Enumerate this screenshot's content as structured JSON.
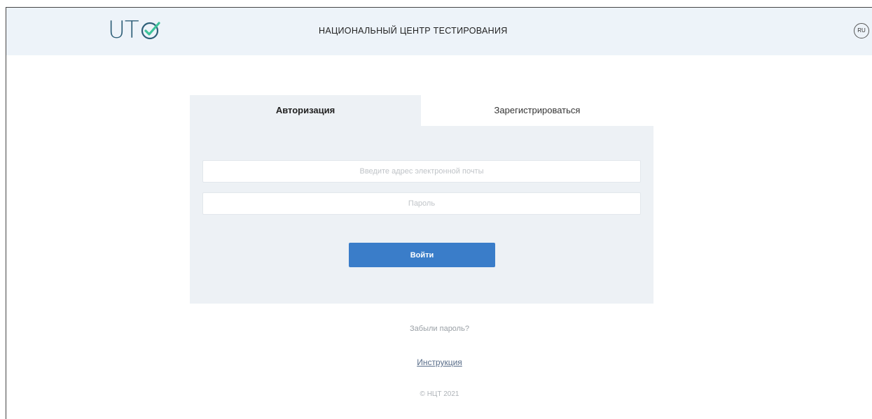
{
  "header": {
    "logo_text": "UT",
    "title": "НАЦИОНАЛЬНЫЙ ЦЕНТР ТЕСТИРОВАНИЯ",
    "language": "RU"
  },
  "tabs": [
    {
      "label": "Авторизация",
      "active": true
    },
    {
      "label": "Зарегистрироваться",
      "active": false
    }
  ],
  "form": {
    "email_placeholder": "Введите адрес электронной почты",
    "password_placeholder": "Пароль",
    "submit_label": "Войти"
  },
  "footer": {
    "forgot_label": "Забыли пароль?",
    "instructions_label": "Инструкция",
    "copyright": "© НЦТ 2021"
  },
  "colors": {
    "header_bg": "#edf3f9",
    "panel_bg": "#edf1f5",
    "accent": "#3a7dc9",
    "logo_check": "#3cc39a"
  }
}
